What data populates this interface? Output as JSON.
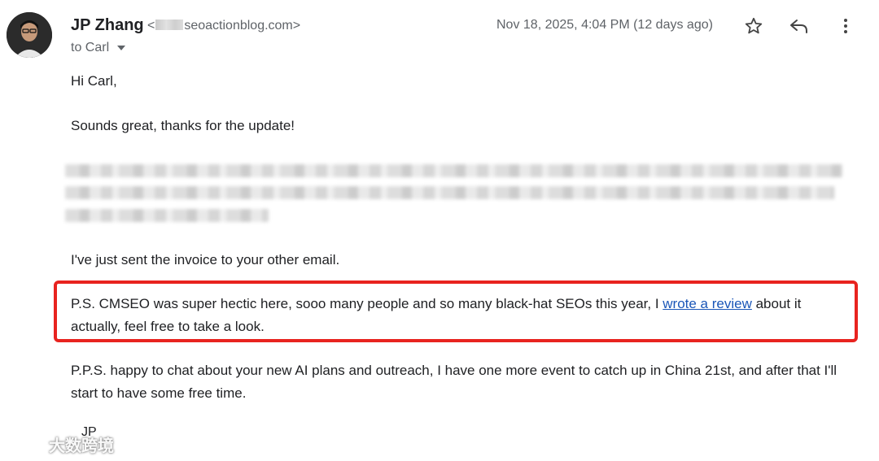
{
  "email": {
    "sender_name": "JP Zhang",
    "sender_email_prefix": "<",
    "sender_email_suffix": "seoactionblog.com>",
    "recipient": "to Carl",
    "date": "Nov 18, 2025, 4:04 PM (12 days ago)",
    "greeting": "Hi Carl,",
    "line1": "Sounds great, thanks for the update!",
    "invoice_line": "I've just sent the invoice to your other email.",
    "ps_before_link": "P.S. CMSEO was super hectic here, sooo many people and so many black-hat SEOs this year, I ",
    "ps_link": "wrote a review",
    "ps_after_link": " about it actually, feel free to take a look.",
    "pps": "P.P.S. happy to chat about your new AI plans and outreach, I have one more event to catch up in China 21st, and after that I'll start to have some free time.",
    "signature": "JP"
  },
  "icons": {
    "star": "star-icon",
    "reply": "reply-icon",
    "more": "more-vert-icon",
    "recipient_caret": "caret-down-icon"
  },
  "watermark": {
    "text": "大数跨境"
  },
  "colors": {
    "highlight_border": "#e8231f",
    "link": "#1a56b8",
    "meta_text": "#5f6368"
  }
}
